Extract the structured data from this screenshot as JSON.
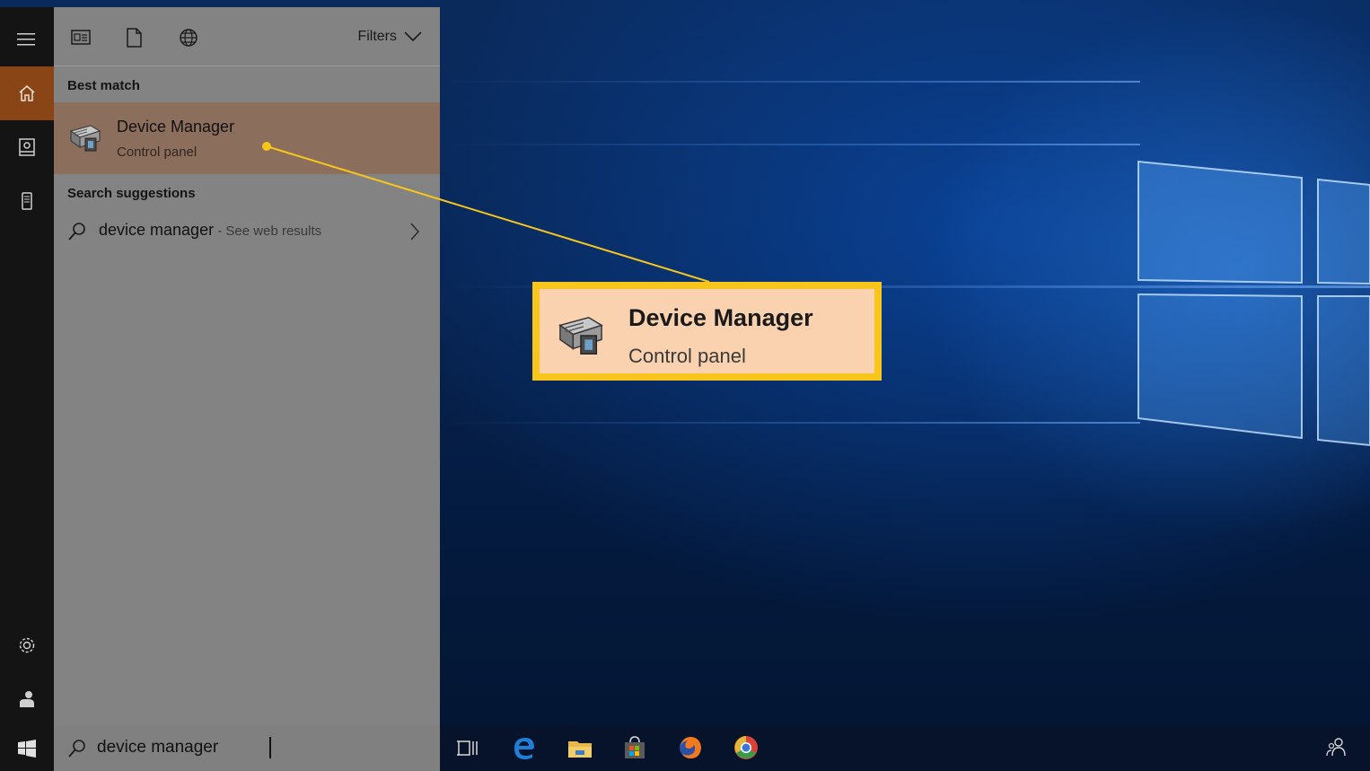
{
  "panel": {
    "filters_label": "Filters",
    "best_match_header": "Best match",
    "best_match": {
      "title": "Device Manager",
      "subtitle": "Control panel",
      "icon": "device-manager-icon"
    },
    "suggestions_header": "Search suggestions",
    "suggestion": {
      "query": "device manager",
      "hint": " - See web results"
    }
  },
  "search": {
    "value": "device manager"
  },
  "callout": {
    "title": "Device Manager",
    "subtitle": "Control panel",
    "border_color": "#f7c51b",
    "fill_color": "#fbd2b0"
  },
  "rail": {
    "items": [
      "menu-icon",
      "home-icon",
      "notebook-icon",
      "phone-icon",
      "settings-icon",
      "user-icon",
      "windows-start-icon"
    ]
  },
  "taskbar": {
    "items": [
      "task-view-icon",
      "edge-icon",
      "file-explorer-icon",
      "store-icon",
      "firefox-icon",
      "chrome-icon",
      "people-icon"
    ]
  },
  "colors": {
    "accent": "#8a4516",
    "selection": "#8c6e5d"
  }
}
